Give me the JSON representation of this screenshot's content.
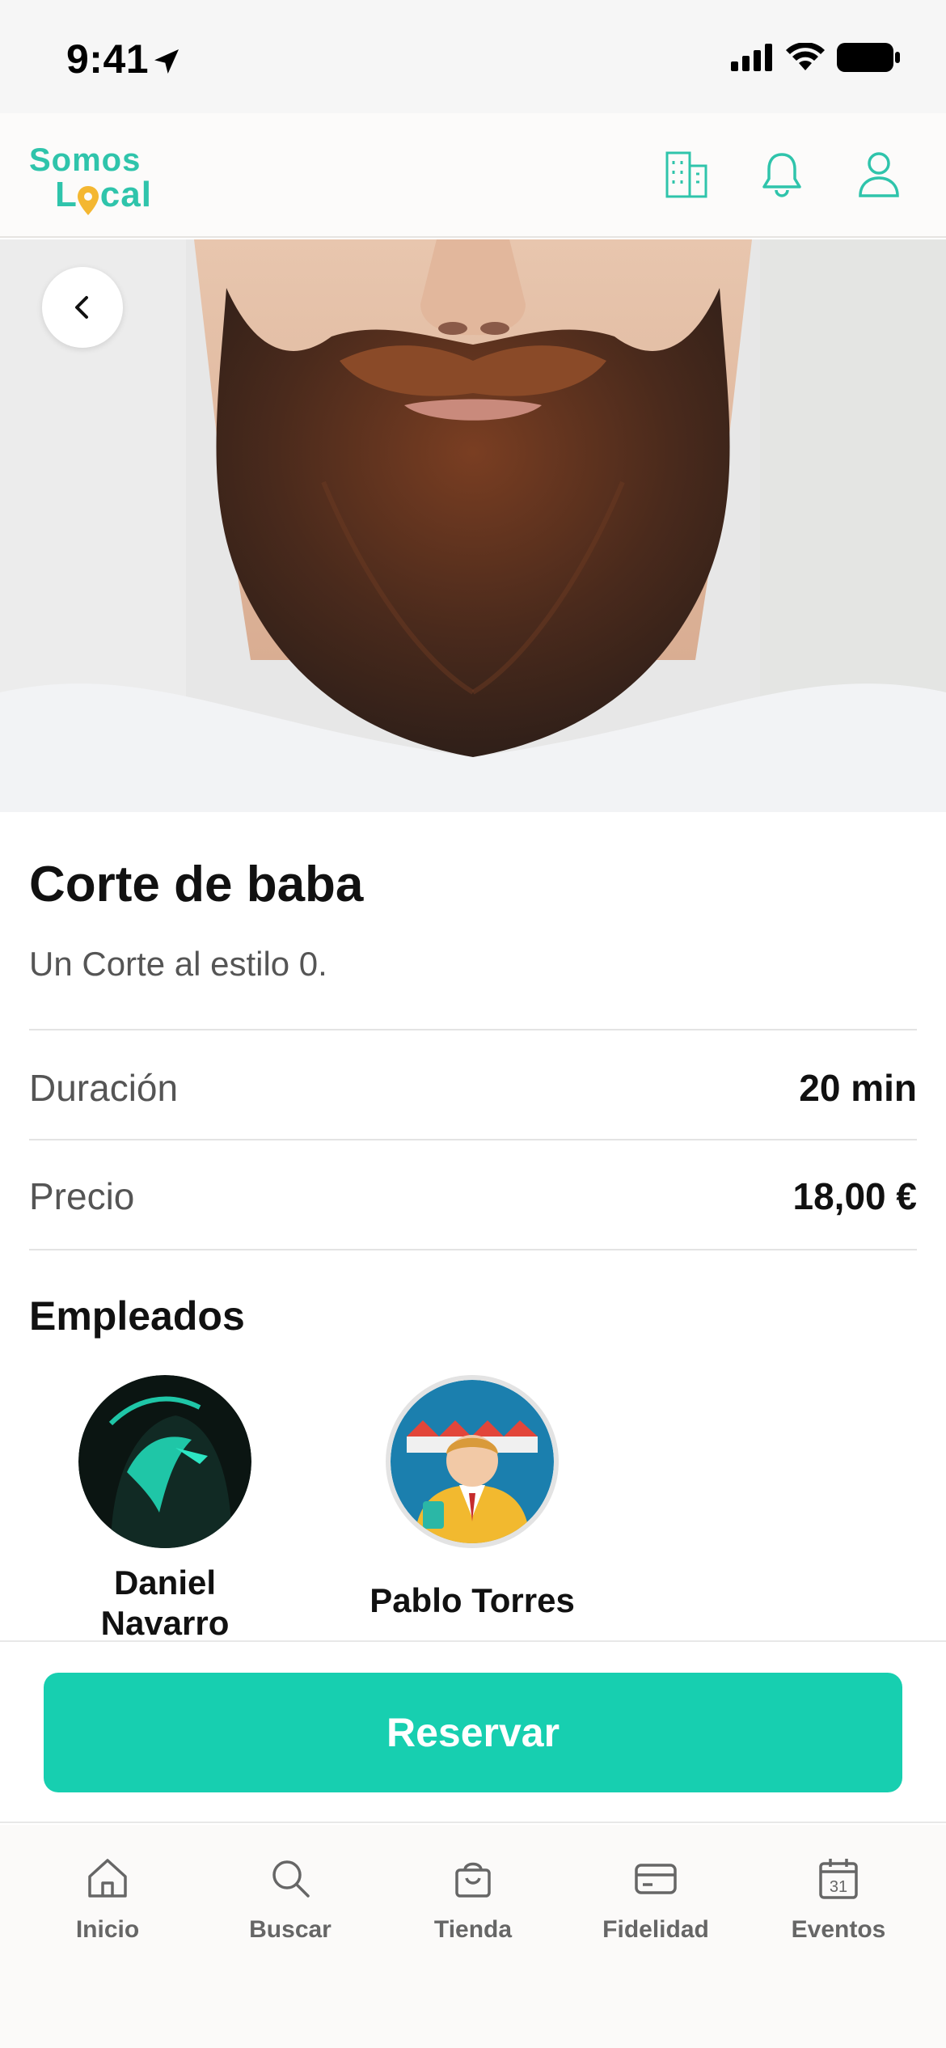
{
  "status_bar": {
    "time": "9:41"
  },
  "header": {
    "logo_line1": "Somos",
    "logo_line2": "Local",
    "icons": [
      "building-icon",
      "bell-icon",
      "user-icon"
    ]
  },
  "service": {
    "title": "Corte de baba",
    "description": "Un Corte al estilo 0.",
    "duration_label": "Duración",
    "duration_value": "20 min",
    "price_label": "Precio",
    "price_value": "18,00 €"
  },
  "employees": {
    "title": "Empleados",
    "items": [
      {
        "name": "Daniel Navarro"
      },
      {
        "name": "Pablo Torres"
      }
    ]
  },
  "actions": {
    "reserve_label": "Reservar"
  },
  "tabs": [
    {
      "label": "Inicio",
      "icon": "home-icon"
    },
    {
      "label": "Buscar",
      "icon": "search-icon"
    },
    {
      "label": "Tienda",
      "icon": "shopping-bag-icon"
    },
    {
      "label": "Fidelidad",
      "icon": "card-icon"
    },
    {
      "label": "Eventos",
      "icon": "calendar-icon",
      "calendar_day": "31"
    }
  ],
  "colors": {
    "accent": "#17cfb0",
    "logo": "#2fc4ab",
    "pin": "#f4b731"
  }
}
